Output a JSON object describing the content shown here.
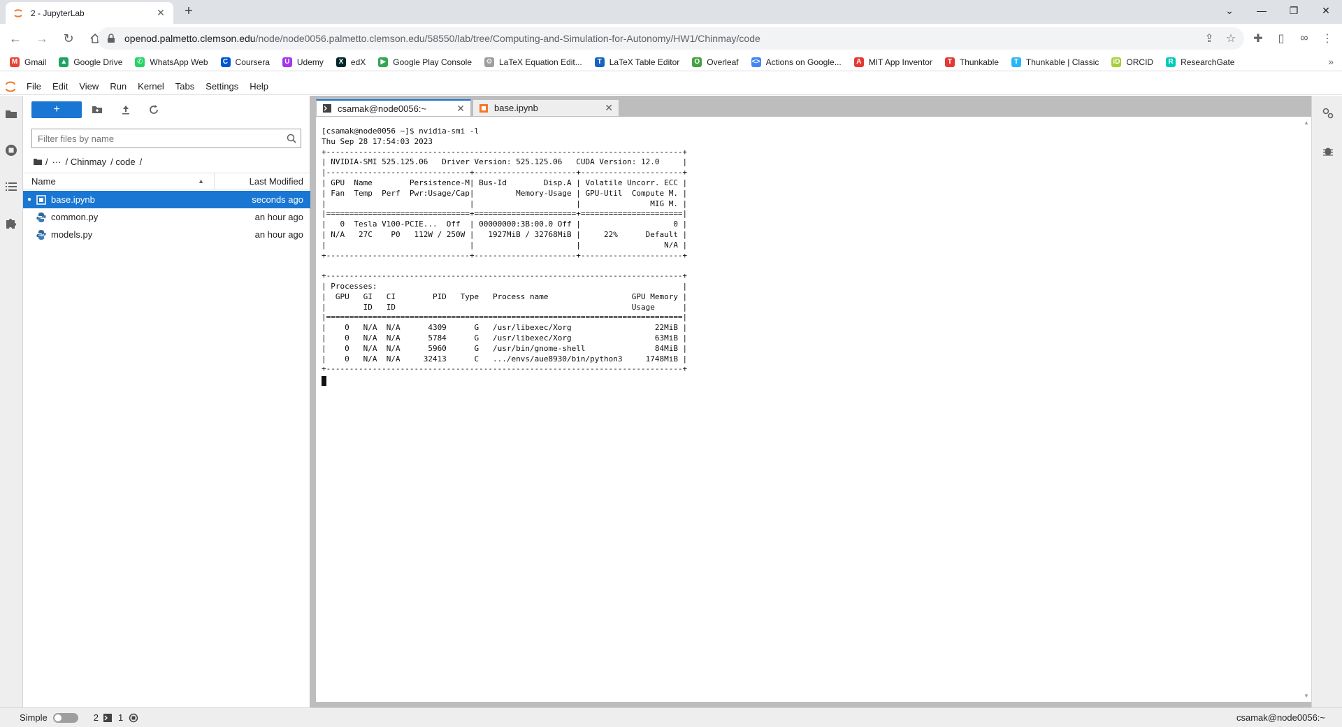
{
  "browser": {
    "tab_title": "2 - JupyterLab",
    "tab_close": "✕",
    "new_tab": "+",
    "url_host": "openod.palmetto.clemson.edu",
    "url_path": "/node/node0056.palmetto.clemson.edu/58550/lab/tree/Computing-and-Simulation-for-Autonomy/HW1/Chinmay/code",
    "bookmarks": [
      {
        "label": "Gmail",
        "icon": "gmail-icon",
        "color": "#ea4335",
        "glyph": "M"
      },
      {
        "label": "Google Drive",
        "icon": "google-drive-icon",
        "color": "#1fa463",
        "glyph": "▲"
      },
      {
        "label": "WhatsApp Web",
        "icon": "whatsapp-icon",
        "color": "#25d366",
        "glyph": "✆"
      },
      {
        "label": "Coursera",
        "icon": "coursera-icon",
        "color": "#0056d2",
        "glyph": "C"
      },
      {
        "label": "Udemy",
        "icon": "udemy-icon",
        "color": "#a435f0",
        "glyph": "U"
      },
      {
        "label": "edX",
        "icon": "edx-icon",
        "color": "#02262b",
        "glyph": "X"
      },
      {
        "label": "Google Play Console",
        "icon": "play-console-icon",
        "color": "#34a853",
        "glyph": "▶"
      },
      {
        "label": "LaTeX Equation Edit...",
        "icon": "latex-equation-icon",
        "color": "#9e9e9e",
        "glyph": "⚙"
      },
      {
        "label": "LaTeX Table Editor",
        "icon": "latex-table-icon",
        "color": "#1565c0",
        "glyph": "T"
      },
      {
        "label": "Overleaf",
        "icon": "overleaf-icon",
        "color": "#47a141",
        "glyph": "O"
      },
      {
        "label": "Actions on Google...",
        "icon": "actions-google-icon",
        "color": "#4285f4",
        "glyph": "<>"
      },
      {
        "label": "MIT App Inventor",
        "icon": "app-inventor-icon",
        "color": "#e53935",
        "glyph": "A"
      },
      {
        "label": "Thunkable",
        "icon": "thunkable-icon",
        "color": "#e53935",
        "glyph": "T"
      },
      {
        "label": "Thunkable | Classic",
        "icon": "thunkable-classic-icon",
        "color": "#29b6f6",
        "glyph": "T"
      },
      {
        "label": "ORCID",
        "icon": "orcid-icon",
        "color": "#a6ce39",
        "glyph": "iD"
      },
      {
        "label": "ResearchGate",
        "icon": "researchgate-icon",
        "color": "#00ccbb",
        "glyph": "R"
      }
    ],
    "bookmarks_more": "»"
  },
  "menubar": {
    "items": [
      "File",
      "Edit",
      "View",
      "Run",
      "Kernel",
      "Tabs",
      "Settings",
      "Help"
    ]
  },
  "filebrowser": {
    "new_label": "+",
    "filter_placeholder": "Filter files by name",
    "breadcrumbs": [
      "/",
      "···",
      "/ Chinmay",
      "/ code",
      "/"
    ],
    "col_name": "Name",
    "col_modified": "Last Modified",
    "files": [
      {
        "name": "base.ipynb",
        "modified": "seconds ago",
        "type": "notebook",
        "selected": true,
        "running": "●"
      },
      {
        "name": "common.py",
        "modified": "an hour ago",
        "type": "python",
        "selected": false,
        "running": ""
      },
      {
        "name": "models.py",
        "modified": "an hour ago",
        "type": "python",
        "selected": false,
        "running": ""
      }
    ]
  },
  "doc_tabs": [
    {
      "label": "csamak@node0056:~",
      "close": "✕",
      "active": true
    },
    {
      "label": "base.ipynb",
      "close": "✕",
      "active": false
    }
  ],
  "terminal": {
    "lines": [
      "[csamak@node0056 ~]$ nvidia-smi -l",
      "Thu Sep 28 17:54:03 2023",
      "+-----------------------------------------------------------------------------+",
      "| NVIDIA-SMI 525.125.06   Driver Version: 525.125.06   CUDA Version: 12.0     |",
      "|-------------------------------+----------------------+----------------------+",
      "| GPU  Name        Persistence-M| Bus-Id        Disp.A | Volatile Uncorr. ECC |",
      "| Fan  Temp  Perf  Pwr:Usage/Cap|         Memory-Usage | GPU-Util  Compute M. |",
      "|                               |                      |               MIG M. |",
      "|===============================+======================+======================|",
      "|   0  Tesla V100-PCIE...  Off  | 00000000:3B:00.0 Off |                    0 |",
      "| N/A   27C    P0   112W / 250W |   1927MiB / 32768MiB |     22%      Default |",
      "|                               |                      |                  N/A |",
      "+-------------------------------+----------------------+----------------------+",
      "",
      "+-----------------------------------------------------------------------------+",
      "| Processes:                                                                  |",
      "|  GPU   GI   CI        PID   Type   Process name                  GPU Memory |",
      "|        ID   ID                                                   Usage      |",
      "|=============================================================================|",
      "|    0   N/A  N/A      4309      G   /usr/libexec/Xorg                  22MiB |",
      "|    0   N/A  N/A      5784      G   /usr/libexec/Xorg                  63MiB |",
      "|    0   N/A  N/A      5960      G   /usr/bin/gnome-shell               84MiB |",
      "|    0   N/A  N/A     32413      C   .../envs/aue8930/bin/python3     1748MiB |",
      "+-----------------------------------------------------------------------------+"
    ]
  },
  "statusbar": {
    "mode": "Simple",
    "terminals_count": "2",
    "kernels_count": "1",
    "right_text": "csamak@node0056:~"
  },
  "colors": {
    "accent": "#1976d2",
    "jupyter_orange": "#f37726"
  }
}
